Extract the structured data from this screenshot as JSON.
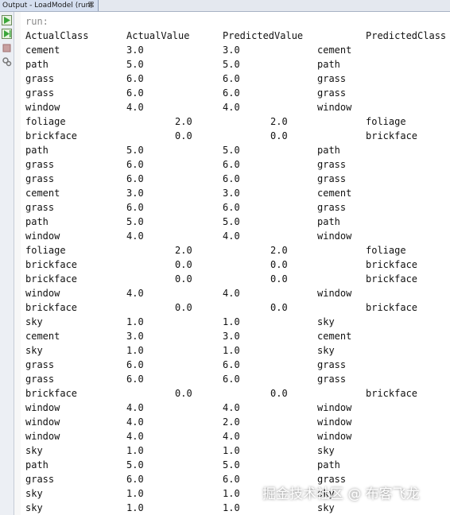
{
  "window": {
    "tab_label": "Output - LoadModel (run)",
    "close_glyph": "⌘"
  },
  "toolbar": {
    "icons": [
      "run-icon",
      "rerun-icon",
      "stop-icon",
      "settings-icon"
    ]
  },
  "output": {
    "run_label": "run:",
    "headers": [
      "ActualClass",
      "ActualValue",
      "PredictedValue",
      "PredictedClass"
    ],
    "rows": [
      [
        "cement",
        "3.0",
        "3.0",
        "cement"
      ],
      [
        "path",
        "5.0",
        "5.0",
        "path"
      ],
      [
        "grass",
        "6.0",
        "6.0",
        "grass"
      ],
      [
        "grass",
        "6.0",
        "6.0",
        "grass"
      ],
      [
        "window",
        "4.0",
        "4.0",
        "window"
      ],
      [
        "foliage",
        "2.0",
        "2.0",
        "foliage"
      ],
      [
        "brickface",
        "0.0",
        "0.0",
        "brickface"
      ],
      [
        "path",
        "5.0",
        "5.0",
        "path"
      ],
      [
        "grass",
        "6.0",
        "6.0",
        "grass"
      ],
      [
        "grass",
        "6.0",
        "6.0",
        "grass"
      ],
      [
        "cement",
        "3.0",
        "3.0",
        "cement"
      ],
      [
        "grass",
        "6.0",
        "6.0",
        "grass"
      ],
      [
        "path",
        "5.0",
        "5.0",
        "path"
      ],
      [
        "window",
        "4.0",
        "4.0",
        "window"
      ],
      [
        "foliage",
        "2.0",
        "2.0",
        "foliage"
      ],
      [
        "brickface",
        "0.0",
        "0.0",
        "brickface"
      ],
      [
        "brickface",
        "0.0",
        "0.0",
        "brickface"
      ],
      [
        "window",
        "4.0",
        "4.0",
        "window"
      ],
      [
        "brickface",
        "0.0",
        "0.0",
        "brickface"
      ],
      [
        "sky",
        "1.0",
        "1.0",
        "sky"
      ],
      [
        "cement",
        "3.0",
        "3.0",
        "cement"
      ],
      [
        "sky",
        "1.0",
        "1.0",
        "sky"
      ],
      [
        "grass",
        "6.0",
        "6.0",
        "grass"
      ],
      [
        "grass",
        "6.0",
        "6.0",
        "grass"
      ],
      [
        "brickface",
        "0.0",
        "0.0",
        "brickface"
      ],
      [
        "window",
        "4.0",
        "4.0",
        "window"
      ],
      [
        "window",
        "4.0",
        "2.0",
        "window"
      ],
      [
        "window",
        "4.0",
        "4.0",
        "window"
      ],
      [
        "sky",
        "1.0",
        "1.0",
        "sky"
      ],
      [
        "path",
        "5.0",
        "5.0",
        "path"
      ],
      [
        "grass",
        "6.0",
        "6.0",
        "grass"
      ],
      [
        "sky",
        "1.0",
        "1.0",
        "sky"
      ],
      [
        "sky",
        "1.0",
        "1.0",
        "sky"
      ]
    ]
  },
  "watermark": "掘金技术社区 @ 布客飞龙"
}
